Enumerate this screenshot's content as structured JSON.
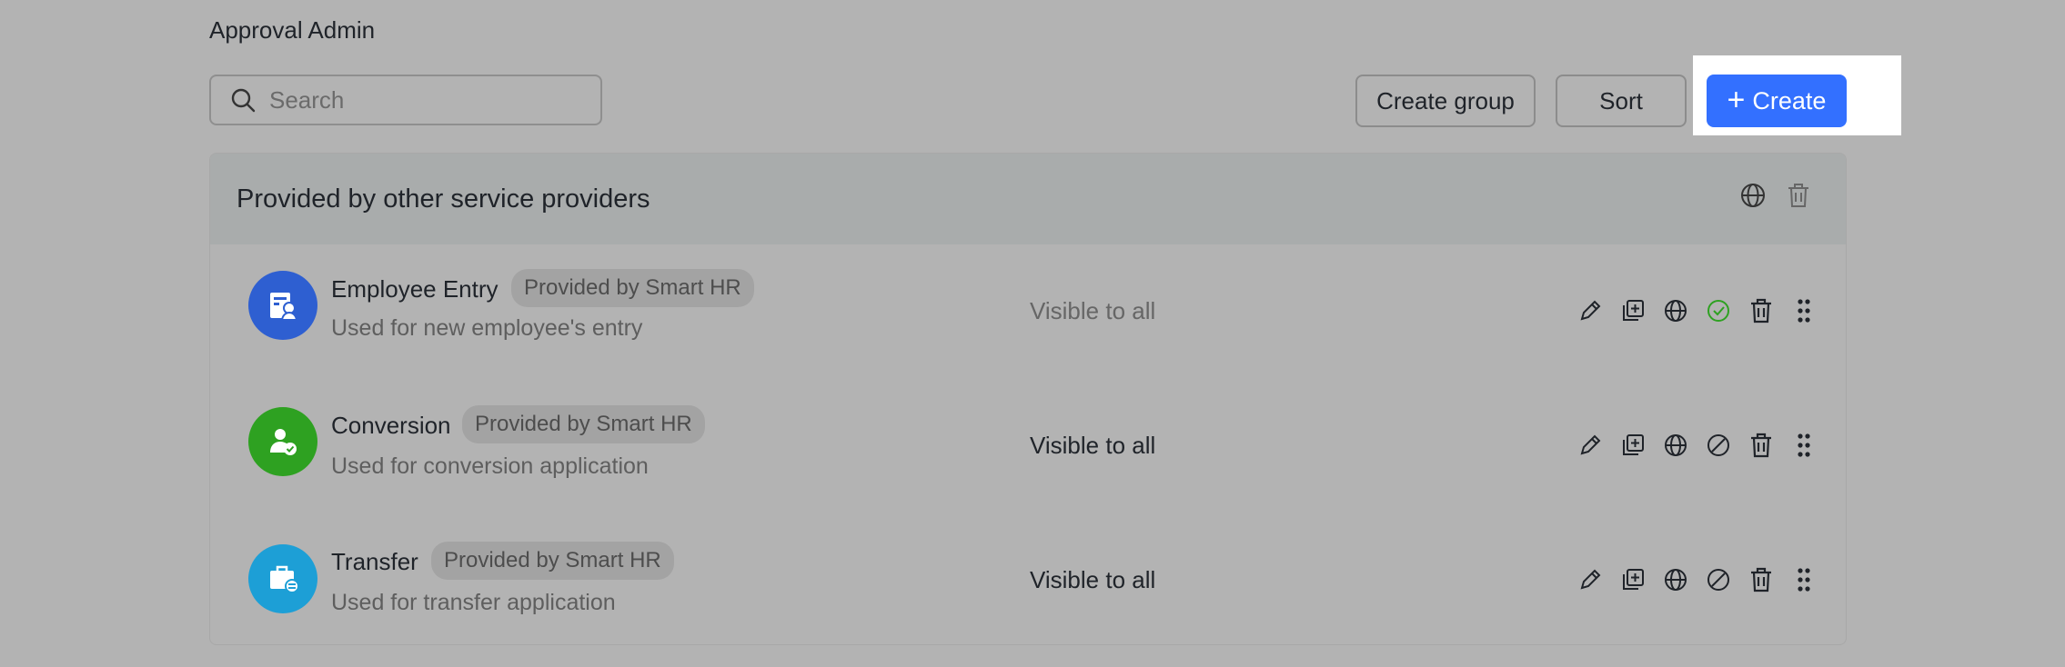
{
  "header": {
    "title": "Approval Admin"
  },
  "search": {
    "placeholder": "Search",
    "value": ""
  },
  "toolbar": {
    "create_group_label": "Create group",
    "sort_label": "Sort",
    "create_label": "Create",
    "create_icon": "plus-icon",
    "accent_color": "#3370ff"
  },
  "group": {
    "title": "Provided by other service providers",
    "header_icons": [
      "globe-icon",
      "trash-icon"
    ],
    "items": [
      {
        "name": "Employee Entry",
        "provider_tag": "Provided by Smart HR",
        "description": "Used for new employee's entry",
        "visibility": "Visible to all",
        "visibility_muted": true,
        "avatar_color": "#2e5fd1",
        "avatar_icon": "form-person-icon",
        "status_icon": "check-circle-icon",
        "status_color": "#2ea121"
      },
      {
        "name": "Conversion",
        "provider_tag": "Provided by Smart HR",
        "description": "Used for conversion application",
        "visibility": "Visible to all",
        "visibility_muted": false,
        "avatar_color": "#2ea121",
        "avatar_icon": "person-check-icon",
        "status_icon": "disable-icon",
        "status_color": "#1f2329"
      },
      {
        "name": "Transfer",
        "provider_tag": "Provided by Smart HR",
        "description": "Used for transfer application",
        "visibility": "Visible to all",
        "visibility_muted": false,
        "avatar_color": "#1d9fd6",
        "avatar_icon": "briefcase-transfer-icon",
        "status_icon": "disable-icon",
        "status_color": "#1f2329"
      }
    ],
    "row_action_icons": [
      "edit-icon",
      "copy-icon",
      "globe-icon",
      "status-icon",
      "trash-icon",
      "drag-handle-icon"
    ]
  }
}
